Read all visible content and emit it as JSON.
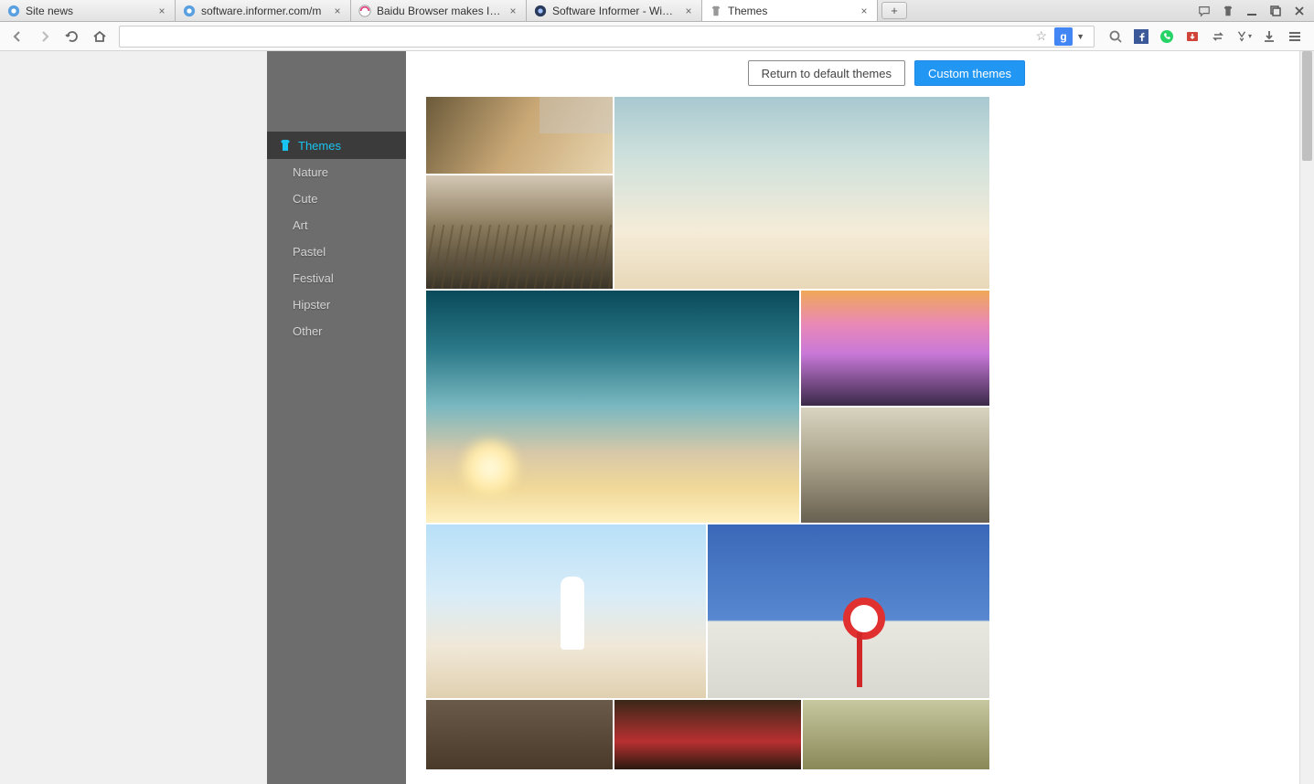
{
  "tabs": [
    {
      "title": "Site news"
    },
    {
      "title": "software.informer.com/m"
    },
    {
      "title": "Baidu Browser makes Inter"
    },
    {
      "title": "Software Informer - Windo"
    },
    {
      "title": "Themes",
      "active": true
    }
  ],
  "window_controls": {
    "new_tab": "+"
  },
  "sidebar": {
    "header": "Themes",
    "categories": [
      "Nature",
      "Cute",
      "Art",
      "Pastel",
      "Festival",
      "Hipster",
      "Other"
    ]
  },
  "buttons": {
    "return_default": "Return to default themes",
    "custom": "Custom themes"
  },
  "urlbar": {
    "value": "",
    "placeholder": ""
  }
}
